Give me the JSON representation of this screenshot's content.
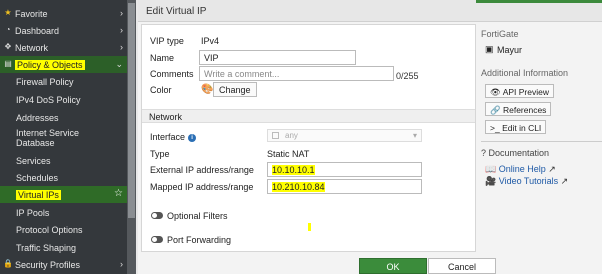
{
  "sidebar": {
    "items": [
      {
        "label": "Favorite",
        "icon": "star-icon",
        "chevron": true
      },
      {
        "label": "Dashboard",
        "icon": "dashboard-icon",
        "chevron": true
      },
      {
        "label": "Network",
        "icon": "network-icon",
        "chevron": true
      },
      {
        "label": "Policy & Objects",
        "icon": "policy-icon",
        "chevron": true
      },
      {
        "label": "Firewall Policy"
      },
      {
        "label": "IPv4 DoS Policy"
      },
      {
        "label": "Addresses"
      },
      {
        "label": "Internet Service"
      },
      {
        "label": "Database"
      },
      {
        "label": "Services"
      },
      {
        "label": "Schedules"
      },
      {
        "label": "Virtual IPs"
      },
      {
        "label": "IP Pools"
      },
      {
        "label": "Protocol Options"
      },
      {
        "label": "Traffic Shaping"
      },
      {
        "label": "Security Profiles",
        "icon": "lock-icon",
        "chevron": true
      }
    ]
  },
  "dialog": {
    "title": "Edit Virtual IP",
    "vip_type_label": "VIP type",
    "vip_type_value": "IPv4",
    "name_label": "Name",
    "name_value": "VIP",
    "comments_label": "Comments",
    "comments_placeholder": "Write a comment...",
    "comments_counter": "0/255",
    "color_label": "Color",
    "color_change_btn": "Change",
    "network_section": "Network",
    "interface_label": "Interface",
    "interface_value": "any",
    "type_label": "Type",
    "type_value": "Static NAT",
    "external_ip_label": "External IP address/range",
    "external_ip_value": "10.10.10.1",
    "mapped_ip_label": "Mapped IP address/range",
    "mapped_ip_value": "10.210.10.84",
    "optional_filters": "Optional Filters",
    "port_forwarding": "Port Forwarding"
  },
  "right_panel": {
    "fortigate_label": "FortiGate",
    "device_name": "Mayur",
    "additional_info": "Additional Information",
    "api_preview": "API Preview",
    "references": "References",
    "edit_in_cli": "Edit in CLI",
    "documentation": "Documentation",
    "online_help": "Online Help",
    "video_tutorials": "Video Tutorials"
  },
  "footer": {
    "ok": "OK",
    "cancel": "Cancel"
  },
  "colors": {
    "sidebar_bg": "#34383c",
    "active_green": "#2f6b27",
    "ok_green": "#3b8c3b",
    "highlight": "#ffff00",
    "link_blue": "#1f5aa6"
  }
}
